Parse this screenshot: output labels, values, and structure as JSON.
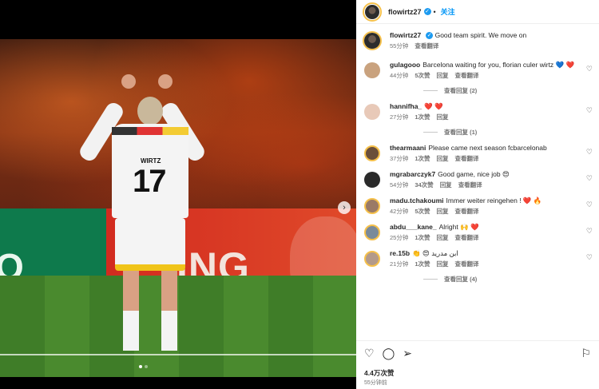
{
  "author": {
    "username": "flowirtz27",
    "follow_label": "关注",
    "separator": "•"
  },
  "media": {
    "jersey_name": "WIRTZ",
    "jersey_number": "17",
    "board_left_text": "O",
    "board_right_text": "ING",
    "next_arrow": "›",
    "slide_count": 2,
    "active_slide": 1
  },
  "caption": {
    "username": "flowirtz27",
    "text": "Good team spirit. We move on",
    "time": "55分钟",
    "translate": "查看翻译"
  },
  "comments": [
    {
      "username": "gulagooo",
      "text": "Barcelona waiting for you, florian culer wirtz 💙 ❤️",
      "time": "44分钟",
      "likes": "5次赞",
      "reply": "回复",
      "translate": "查看翻译",
      "replies": "查看回复 (2)"
    },
    {
      "username": "hannifha_",
      "text": "❤️ ❤️",
      "time": "27分钟",
      "likes": "1次赞",
      "reply": "回复",
      "translate": "",
      "replies": "查看回复 (1)"
    },
    {
      "username": "thearmaani",
      "text": "Please came next season fcbarcelonab",
      "time": "37分钟",
      "likes": "1次赞",
      "reply": "回复",
      "translate": "查看翻译",
      "replies": ""
    },
    {
      "username": "mgrabarczyk7",
      "text": "Good game, nice job 😍",
      "time": "54分钟",
      "likes": "34次赞",
      "reply": "回复",
      "translate": "查看翻译",
      "replies": ""
    },
    {
      "username": "madu.tchakoumi",
      "text": "Immer weiter reingehen ! ❤️ 🔥",
      "time": "42分钟",
      "likes": "5次赞",
      "reply": "回复",
      "translate": "查看翻译",
      "replies": ""
    },
    {
      "username": "abdu___kane_",
      "text": "Alright 🙌 ❤️",
      "time": "25分钟",
      "likes": "1次赞",
      "reply": "回复",
      "translate": "查看翻译",
      "replies": ""
    },
    {
      "username": "re.15b",
      "text": "👏 😍 ابن مدريد",
      "time": "21分钟",
      "likes": "1次赞",
      "reply": "回复",
      "translate": "查看翻译",
      "replies": "查看回复 (4)"
    }
  ],
  "actions": {
    "like_icon": "heart-icon",
    "comment_icon": "comment-icon",
    "share_icon": "share-icon",
    "save_icon": "bookmark-icon"
  },
  "likes_count": "4.4万次赞",
  "posted_time": "55分钟前"
}
